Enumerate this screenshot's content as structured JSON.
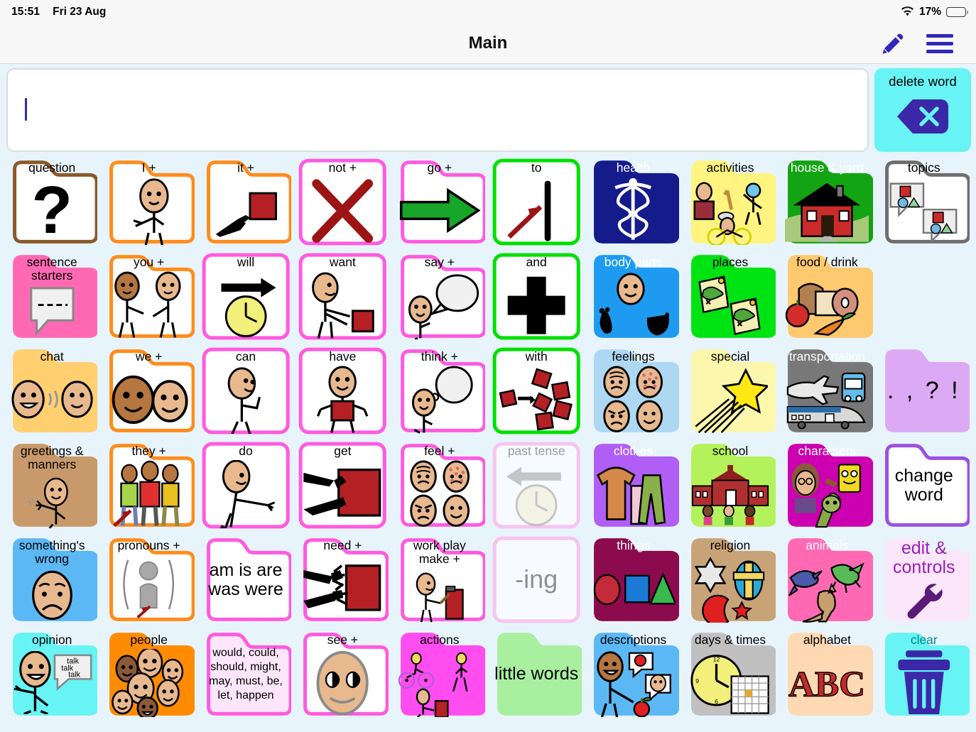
{
  "status_bar": {
    "time": "15:51",
    "date": "Fri 23 Aug",
    "battery_percent": "17%",
    "wifi_icon": "wifi-icon",
    "battery_icon": "battery-icon"
  },
  "nav": {
    "title": "Main",
    "edit_icon": "pencil-icon",
    "menu_icon": "hamburger-menu-icon",
    "accent": "#3028bb"
  },
  "message_bar": {
    "value": "",
    "placeholder": "",
    "caret_color": "#3028bb"
  },
  "delete_word": {
    "label": "delete word",
    "icon": "backspace-icon",
    "bg": "#68f3f5",
    "icon_color": "#3b28a8"
  },
  "grid": {
    "columns": 10,
    "rows": 6,
    "cells": [
      {
        "label": "question",
        "icon": "question-mark-icon",
        "bg": "#ffffff",
        "border": "#8a5a2b",
        "text": "#000000",
        "folder": true,
        "row": 1,
        "col": 1
      },
      {
        "label": "I +",
        "icon": "person-pointing-self-icon",
        "bg": "#ffffff",
        "border": "#ff8c1a",
        "text": "#000000",
        "folder": true,
        "row": 1,
        "col": 2
      },
      {
        "label": "it +",
        "icon": "hand-pointing-object-icon",
        "bg": "#ffffff",
        "border": "#ff8c1a",
        "text": "#000000",
        "folder": true,
        "row": 1,
        "col": 3
      },
      {
        "label": "not +",
        "icon": "red-x-icon",
        "bg": "#ffffff",
        "border": "#ff5ae0",
        "text": "#000000",
        "folder": false,
        "row": 1,
        "col": 4
      },
      {
        "label": "go +",
        "icon": "green-arrow-right-icon",
        "bg": "#ffffff",
        "border": "#ff5ae0",
        "text": "#000000",
        "folder": true,
        "row": 1,
        "col": 5
      },
      {
        "label": "to",
        "icon": "arrow-to-line-icon",
        "bg": "#ffffff",
        "border": "#00e000",
        "text": "#000000",
        "folder": false,
        "row": 1,
        "col": 6
      },
      {
        "label": "health",
        "icon": "caduceus-icon",
        "bg": "#151b8b",
        "border": "#151b8b",
        "text": "#ffffff",
        "folder": true,
        "row": 1,
        "col": 7
      },
      {
        "label": "activities",
        "icon": "activities-icon",
        "bg": "#fff47f",
        "border": "#fff47f",
        "text": "#000000",
        "folder": true,
        "row": 1,
        "col": 8
      },
      {
        "label": "house & yard",
        "icon": "house-icon",
        "bg": "#13a413",
        "border": "#13a413",
        "text": "#ffffff",
        "folder": true,
        "row": 1,
        "col": 9
      },
      {
        "label": "topics",
        "icon": "speech-bubbles-shapes-icon",
        "bg": "#ffffff",
        "border": "#6e6e6e",
        "text": "#000000",
        "folder": true,
        "row": 1,
        "col": 10
      },
      {
        "label": "sentence starters",
        "icon": "speech-bubble-dashes-icon",
        "bg": "#ff69b4",
        "border": "#ff69b4",
        "text": "#000000",
        "folder": true,
        "row": 2,
        "col": 1
      },
      {
        "label": "you +",
        "icon": "two-people-pointing-icon",
        "bg": "#ffffff",
        "border": "#ff8c1a",
        "text": "#000000",
        "folder": true,
        "row": 2,
        "col": 2
      },
      {
        "label": "will",
        "icon": "arrow-clock-icon",
        "bg": "#ffffff",
        "border": "#ff5ae0",
        "text": "#000000",
        "folder": false,
        "row": 2,
        "col": 3
      },
      {
        "label": "want",
        "icon": "person-reaching-icon",
        "bg": "#ffffff",
        "border": "#ff5ae0",
        "text": "#000000",
        "folder": false,
        "row": 2,
        "col": 4
      },
      {
        "label": "say +",
        "icon": "person-speech-bubble-icon",
        "bg": "#ffffff",
        "border": "#ff5ae0",
        "text": "#000000",
        "folder": true,
        "row": 2,
        "col": 5
      },
      {
        "label": "and",
        "icon": "plus-sign-icon",
        "bg": "#ffffff",
        "border": "#00e000",
        "text": "#000000",
        "folder": false,
        "row": 2,
        "col": 6
      },
      {
        "label": "body parts",
        "icon": "body-parts-icon",
        "bg": "#1e9bf0",
        "border": "#1e9bf0",
        "text": "#ffffff",
        "folder": true,
        "row": 2,
        "col": 7
      },
      {
        "label": "places",
        "icon": "treasure-maps-icon",
        "bg": "#00e312",
        "border": "#00e312",
        "text": "#000000",
        "folder": true,
        "row": 2,
        "col": 8
      },
      {
        "label": "food / drink",
        "icon": "food-icon",
        "bg": "#ffc970",
        "border": "#ffc970",
        "text": "#000000",
        "folder": true,
        "row": 2,
        "col": 9
      },
      {
        "label": "",
        "icon": "",
        "bg": "",
        "border": "",
        "text": "",
        "folder": false,
        "row": 2,
        "col": 10
      },
      {
        "label": "chat",
        "icon": "two-faces-talking-icon",
        "bg": "#ffcf70",
        "border": "#ffcf70",
        "text": "#000000",
        "folder": true,
        "row": 3,
        "col": 1
      },
      {
        "label": "we +",
        "icon": "two-faces-icon",
        "bg": "#ffffff",
        "border": "#ff8c1a",
        "text": "#000000",
        "folder": true,
        "row": 3,
        "col": 2
      },
      {
        "label": "can",
        "icon": "person-flexing-icon",
        "bg": "#ffffff",
        "border": "#ff5ae0",
        "text": "#000000",
        "folder": false,
        "row": 3,
        "col": 3
      },
      {
        "label": "have",
        "icon": "person-holding-icon",
        "bg": "#ffffff",
        "border": "#ff5ae0",
        "text": "#000000",
        "folder": false,
        "row": 3,
        "col": 4
      },
      {
        "label": "think +",
        "icon": "person-thought-bubble-icon",
        "bg": "#ffffff",
        "border": "#ff5ae0",
        "text": "#000000",
        "folder": true,
        "row": 3,
        "col": 5
      },
      {
        "label": "with",
        "icon": "blocks-together-icon",
        "bg": "#ffffff",
        "border": "#00e000",
        "text": "#000000",
        "folder": false,
        "row": 3,
        "col": 6
      },
      {
        "label": "feelings",
        "icon": "four-faces-icon",
        "bg": "#aed8f2",
        "border": "#aed8f2",
        "text": "#000000",
        "folder": true,
        "row": 3,
        "col": 7
      },
      {
        "label": "special",
        "icon": "shooting-star-icon",
        "bg": "#fdf7ad",
        "border": "#fdf7ad",
        "text": "#000000",
        "folder": true,
        "row": 3,
        "col": 8
      },
      {
        "label": "transportation",
        "icon": "vehicles-icon",
        "bg": "#787878",
        "border": "#787878",
        "text": "#ffffff",
        "folder": true,
        "row": 3,
        "col": 9
      },
      {
        "label": ". , ? !",
        "icon": "",
        "bg": "#dcaaf5",
        "border": "#dcaaf5",
        "text": "#000000",
        "folder": true,
        "row": 3,
        "col": 10,
        "text_only": true,
        "big_text": true
      },
      {
        "label": "greetings & manners",
        "icon": "person-waving-icon",
        "bg": "#c89a6b",
        "border": "#c89a6b",
        "text": "#000000",
        "folder": true,
        "row": 4,
        "col": 1
      },
      {
        "label": "they +",
        "icon": "three-people-icon",
        "bg": "#ffffff",
        "border": "#ff8c1a",
        "text": "#000000",
        "folder": true,
        "row": 4,
        "col": 2
      },
      {
        "label": "do",
        "icon": "person-gesturing-icon",
        "bg": "#ffffff",
        "border": "#ff5ae0",
        "text": "#000000",
        "folder": false,
        "row": 4,
        "col": 3
      },
      {
        "label": "get",
        "icon": "hands-grabbing-icon",
        "bg": "#ffffff",
        "border": "#ff5ae0",
        "text": "#000000",
        "folder": false,
        "row": 4,
        "col": 4
      },
      {
        "label": "feel +",
        "icon": "four-faces-icon",
        "bg": "#ffffff",
        "border": "#ff5ae0",
        "text": "#000000",
        "folder": true,
        "row": 4,
        "col": 5
      },
      {
        "label": "past tense",
        "icon": "arrow-left-clock-icon",
        "bg": "#f7fbff",
        "border": "#f7c4ef",
        "text": "#9a9a9a",
        "folder": false,
        "row": 4,
        "col": 6,
        "disabled": true
      },
      {
        "label": "clothes",
        "icon": "clothes-icon",
        "bg": "#b05ef5",
        "border": "#b05ef5",
        "text": "#ffffff",
        "folder": true,
        "row": 4,
        "col": 7
      },
      {
        "label": "school",
        "icon": "school-building-icon",
        "bg": "#b3f25a",
        "border": "#b3f25a",
        "text": "#000000",
        "folder": true,
        "row": 4,
        "col": 8
      },
      {
        "label": "characters",
        "icon": "characters-icon",
        "bg": "#cc00b0",
        "border": "#cc00b0",
        "text": "#ffffff",
        "folder": true,
        "row": 4,
        "col": 9
      },
      {
        "label": "change word",
        "icon": "",
        "bg": "#ffffff",
        "border": "#9b51e0",
        "text": "#000000",
        "folder": true,
        "row": 4,
        "col": 10,
        "text_only": true,
        "big_text": true
      },
      {
        "label": "something's wrong",
        "icon": "sad-face-icon",
        "bg": "#5bb8f5",
        "border": "#5bb8f5",
        "text": "#000000",
        "folder": true,
        "row": 5,
        "col": 1
      },
      {
        "label": "pronouns +",
        "icon": "generic-person-icon",
        "bg": "#ffffff",
        "border": "#ff8c1a",
        "text": "#000000",
        "folder": true,
        "row": 5,
        "col": 2
      },
      {
        "label": "am is are was were",
        "icon": "",
        "bg": "#ffffff",
        "border": "#ff5ae0",
        "text": "#000000",
        "folder": true,
        "row": 5,
        "col": 3,
        "text_only": true,
        "big_text": true
      },
      {
        "label": "need +",
        "icon": "hands-reaching-icon",
        "bg": "#ffffff",
        "border": "#ff5ae0",
        "text": "#000000",
        "folder": true,
        "row": 5,
        "col": 4
      },
      {
        "label": "work play make +",
        "icon": "person-hammering-icon",
        "bg": "#ffffff",
        "border": "#ff5ae0",
        "text": "#000000",
        "folder": true,
        "row": 5,
        "col": 5
      },
      {
        "label": "-ing",
        "icon": "",
        "bg": "#f7fbff",
        "border": "#f7c4ef",
        "text": "#8f8f8f",
        "folder": false,
        "row": 5,
        "col": 6,
        "text_only": true,
        "big_text": true,
        "disabled": true
      },
      {
        "label": "things",
        "icon": "shapes-icon",
        "bg": "#8c0a4e",
        "border": "#8c0a4e",
        "text": "#ffffff",
        "folder": true,
        "row": 5,
        "col": 7
      },
      {
        "label": "religion",
        "icon": "religion-symbols-icon",
        "bg": "#c8a378",
        "border": "#c8a378",
        "text": "#000000",
        "folder": true,
        "row": 5,
        "col": 8
      },
      {
        "label": "animals",
        "icon": "animals-icon",
        "bg": "#ff69b4",
        "border": "#ff69b4",
        "text": "#ffffff",
        "folder": true,
        "row": 5,
        "col": 9
      },
      {
        "label": "edit & controls",
        "icon": "wrench-icon",
        "bg": "#fbe6fb",
        "border": "#fbe6fb",
        "text": "#9b1fb5",
        "folder": true,
        "row": 5,
        "col": 10,
        "big_text": true
      },
      {
        "label": "opinion",
        "icon": "person-talk-bubble-icon",
        "bg": "#68f3f5",
        "border": "#68f3f5",
        "text": "#000000",
        "folder": true,
        "row": 6,
        "col": 1
      },
      {
        "label": "people",
        "icon": "group-faces-icon",
        "bg": "#ff8c00",
        "border": "#ff8c00",
        "text": "#000000",
        "folder": true,
        "row": 6,
        "col": 2
      },
      {
        "label": "would, could, should, might, may, must, be, let, happen",
        "icon": "",
        "bg": "#fde6fb",
        "border": "#ff5ae0",
        "text": "#000000",
        "folder": true,
        "row": 6,
        "col": 3,
        "text_only": true
      },
      {
        "label": "see +",
        "icon": "eyes-face-icon",
        "bg": "#ffffff",
        "border": "#ff5ae0",
        "text": "#000000",
        "folder": true,
        "row": 6,
        "col": 4
      },
      {
        "label": "actions",
        "icon": "actions-icon",
        "bg": "#ff4df0",
        "border": "#ff4df0",
        "text": "#000000",
        "folder": true,
        "row": 6,
        "col": 5
      },
      {
        "label": "little words",
        "icon": "",
        "bg": "#a8f0a0",
        "border": "#a8f0a0",
        "text": "#000000",
        "folder": true,
        "row": 6,
        "col": 6,
        "text_only": true,
        "big_text": true
      },
      {
        "label": "descriptions",
        "icon": "describing-person-icon",
        "bg": "#5bb8f5",
        "border": "#5bb8f5",
        "text": "#000000",
        "folder": true,
        "row": 6,
        "col": 7
      },
      {
        "label": "days & times",
        "icon": "clock-calendar-icon",
        "bg": "#c0c0c0",
        "border": "#c0c0c0",
        "text": "#000000",
        "folder": true,
        "row": 6,
        "col": 8
      },
      {
        "label": "alphabet",
        "icon": "abc-icon",
        "bg": "#ffd9b3",
        "border": "#ffd9b3",
        "text": "#000000",
        "folder": true,
        "row": 6,
        "col": 9
      },
      {
        "label": "clear",
        "icon": "trash-icon",
        "bg": "#68f3f5",
        "border": "#68f3f5",
        "text": "#008a8a",
        "folder": true,
        "row": 6,
        "col": 10
      }
    ]
  }
}
